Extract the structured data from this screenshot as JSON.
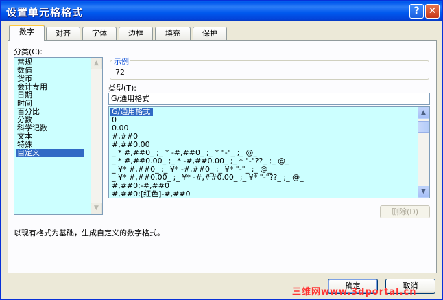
{
  "window": {
    "title": "设置单元格格式"
  },
  "title_buttons": {
    "help": "?",
    "close": "✕"
  },
  "tabs": [
    {
      "label": "数字",
      "active": true
    },
    {
      "label": "对齐",
      "active": false
    },
    {
      "label": "字体",
      "active": false
    },
    {
      "label": "边框",
      "active": false
    },
    {
      "label": "填充",
      "active": false
    },
    {
      "label": "保护",
      "active": false
    }
  ],
  "category": {
    "label": "分类(C):",
    "items": [
      "常规",
      "数值",
      "货币",
      "会计专用",
      "日期",
      "时间",
      "百分比",
      "分数",
      "科学记数",
      "文本",
      "特殊",
      "自定义"
    ],
    "selected_index": 11
  },
  "sample": {
    "label": "示例",
    "value": "72"
  },
  "type": {
    "label": "类型(T):",
    "value": "G/通用格式",
    "items": [
      "G/通用格式",
      "0",
      "0.00",
      "#,##0",
      "#,##0.00",
      "_ * #,##0_ ;_ * -#,##0_ ;_ * \"-\"_ ;_ @_",
      "_ * #,##0.00_ ;_ * -#,##0.00_ ;_ * \"-\"??_ ;_ @_",
      "_ ¥* #,##0_ ;_ ¥* -#,##0_ ;_ ¥* \"-\"_ ;_ @_",
      "_ ¥* #,##0.00_ ;_ ¥* -#,##0.00_ ;_ ¥* \"-\"??_ ;_ @_",
      "#,##0;-#,##0",
      "#,##0;[红色]-#,##0"
    ],
    "selected_index": 0
  },
  "delete_button": "删除(D)",
  "description": "以现有格式为基础，生成自定义的数字格式。",
  "ok_button": "确定",
  "cancel_button": "取消",
  "watermark": "三维网www.3dportal.cn",
  "icons": {
    "scroll_up": "▲",
    "scroll_down": "▼"
  },
  "colors": {
    "title_bar": "#0058ee",
    "list_bg": "#ccffff",
    "selection": "#316ac5"
  }
}
